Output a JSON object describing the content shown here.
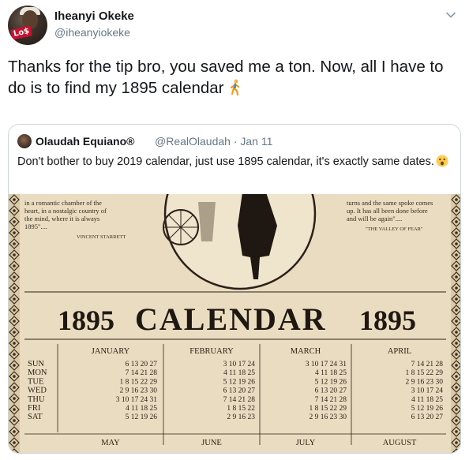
{
  "tweet": {
    "author_name": "Iheanyi Okeke",
    "author_handle": "@iheanyiokeke",
    "avatar_badge": "Lo$",
    "text": "Thanks for the tip bro, you saved me a ton. Now, all I have to do is to find my 1895 calendar",
    "trailing_emoji": "person-walking-emoji"
  },
  "quoted_tweet": {
    "author_name": "Olaudah Equiano®",
    "author_handle": "@RealOlaudah",
    "separator": "·",
    "date": "Jan 11",
    "text": "Don't bother to buy 2019 calendar, just use 1895 calendar, it's exactly same dates.",
    "trailing_emoji": "astonished-face-emoji"
  },
  "calendar": {
    "year_left": "1895",
    "title": "CALENDAR",
    "year_right": "1895",
    "text_left": [
      "in a romantic chamber of the",
      "heart, in a nostalgic country of",
      "the mind, where it is always",
      "1895\"...."
    ],
    "text_left_credit": "VINCENT STARRETT",
    "text_right": [
      "turns and the same spoke comes",
      "up. It has all been done before",
      "and will be again\"...."
    ],
    "text_right_credit": "\"THE VALLEY OF FEAR\"",
    "weekdays": [
      "SUN",
      "MON",
      "TUE",
      "WED",
      "THU",
      "FRI",
      "SAT"
    ],
    "months_top": [
      {
        "name": "JANUARY",
        "rows": [
          "6 13 20 27",
          "7 14 21 28",
          "1  8 15 22 29",
          "2  9 16 23 30",
          "3 10 17 24 31",
          "4 11 18 25",
          "5 12 19 26"
        ]
      },
      {
        "name": "FEBRUARY",
        "rows": [
          "3 10 17 24",
          "4 11 18 25",
          "5 12 19 26",
          "6 13 20 27",
          "7 14 21 28",
          "1  8 15 22",
          "2  9 16 23"
        ]
      },
      {
        "name": "MARCH",
        "rows": [
          "3 10 17 24 31",
          "4 11 18 25",
          "5 12 19 26",
          "6 13 20 27",
          "7 14 21 28",
          "1  8 15 22 29",
          "2  9 16 23 30"
        ]
      },
      {
        "name": "APRIL",
        "rows": [
          "7 14 21 28",
          "1  8 15 22 29",
          "2  9 16 23 30",
          "3 10 17 24",
          "4 11 18 25",
          "5 12 19 26",
          "6 13 20 27"
        ]
      }
    ],
    "months_bottom": [
      "MAY",
      "JUNE",
      "JULY",
      "AUGUST"
    ]
  },
  "colors": {
    "text_primary": "#14171a",
    "text_secondary": "#657786",
    "border": "#ccd6dd",
    "paper": "#eadcc0",
    "ink": "#2b211a"
  }
}
